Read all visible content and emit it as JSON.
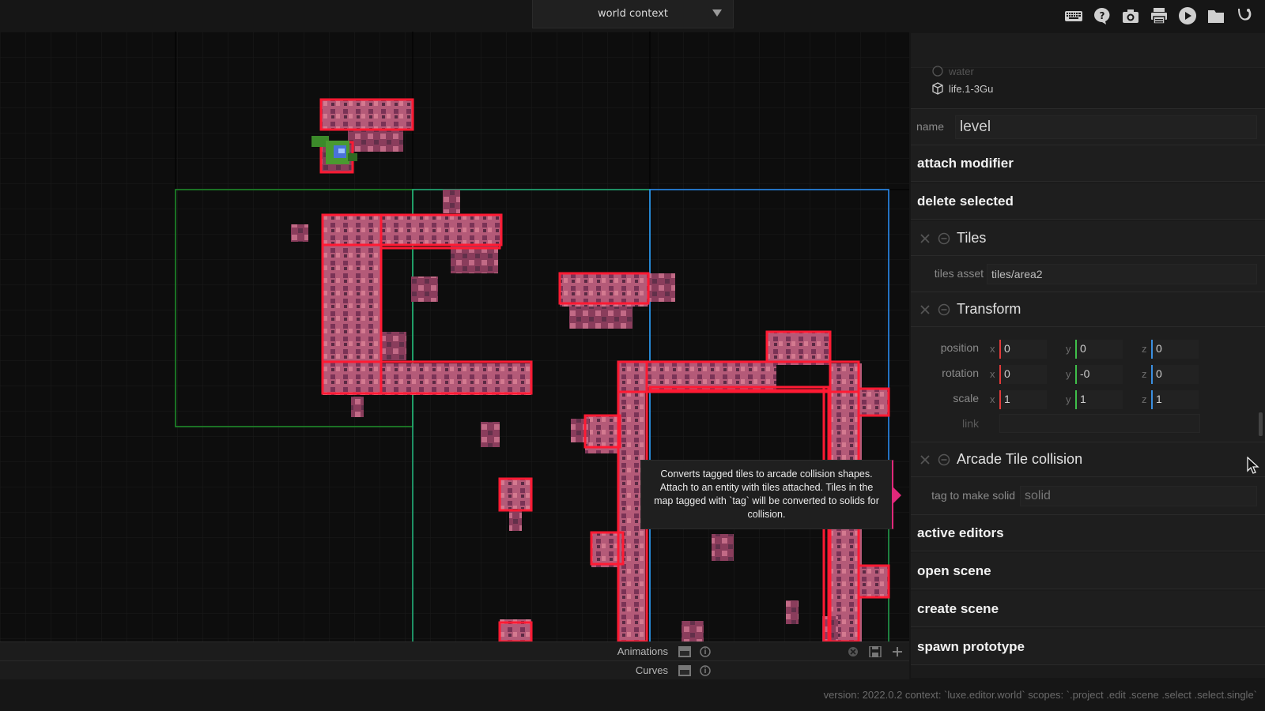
{
  "context_select": {
    "value": "world context"
  },
  "toolbar": {
    "icons": [
      "keyboard-icon",
      "help-icon",
      "camera-icon",
      "printer-icon",
      "play-icon",
      "folder-icon",
      "luxe-logo-icon"
    ]
  },
  "viewport": {
    "tooltip": "Converts tagged tiles to arcade collision shapes. Attach to an entity with tiles attached. Tiles in the map tagged with `tag` will be converted to solids for collision."
  },
  "bottom_panels": {
    "animations": "Animations",
    "curves": "Curves"
  },
  "status": {
    "text": "version: 2022.0.2 context: `luxe.editor.world` scopes: `.project .edit .scene .select .select.single`"
  },
  "inspector": {
    "entities": [
      {
        "label": "water",
        "faded": true
      },
      {
        "label": "life.1-3Gu",
        "faded": false
      }
    ],
    "name": {
      "label": "name",
      "value": "level"
    },
    "actions": {
      "attach_modifier": "attach modifier",
      "delete_selected": "delete selected",
      "active_editors": "active editors",
      "open_scene": "open scene",
      "create_scene": "create scene",
      "spawn_prototype": "spawn prototype"
    },
    "tiles": {
      "title": "Tiles",
      "asset_label": "tiles asset",
      "asset_value": "tiles/area2"
    },
    "transform": {
      "title": "Transform",
      "position": {
        "label": "position",
        "x": "0",
        "y": "0",
        "z": "0"
      },
      "rotation": {
        "label": "rotation",
        "x": "0",
        "y": "-0",
        "z": "0"
      },
      "scale": {
        "label": "scale",
        "x": "1",
        "y": "1",
        "z": "1"
      },
      "link_label": "link",
      "axis_x": "x",
      "axis_y": "y",
      "axis_z": "z"
    },
    "arcade": {
      "title": "Arcade Tile collision",
      "tag_label": "tag to make solid",
      "tag_placeholder": "solid"
    }
  },
  "colors": {
    "background": "#161616",
    "viewport": "#0d0d0d",
    "collision_red": "#ff1a33",
    "tile_pink": "#c06080",
    "tooltip_accent": "#e0287a",
    "axis_x": "#e33a3a",
    "axis_y": "#3fbf4a",
    "axis_z": "#3b8fe0"
  }
}
